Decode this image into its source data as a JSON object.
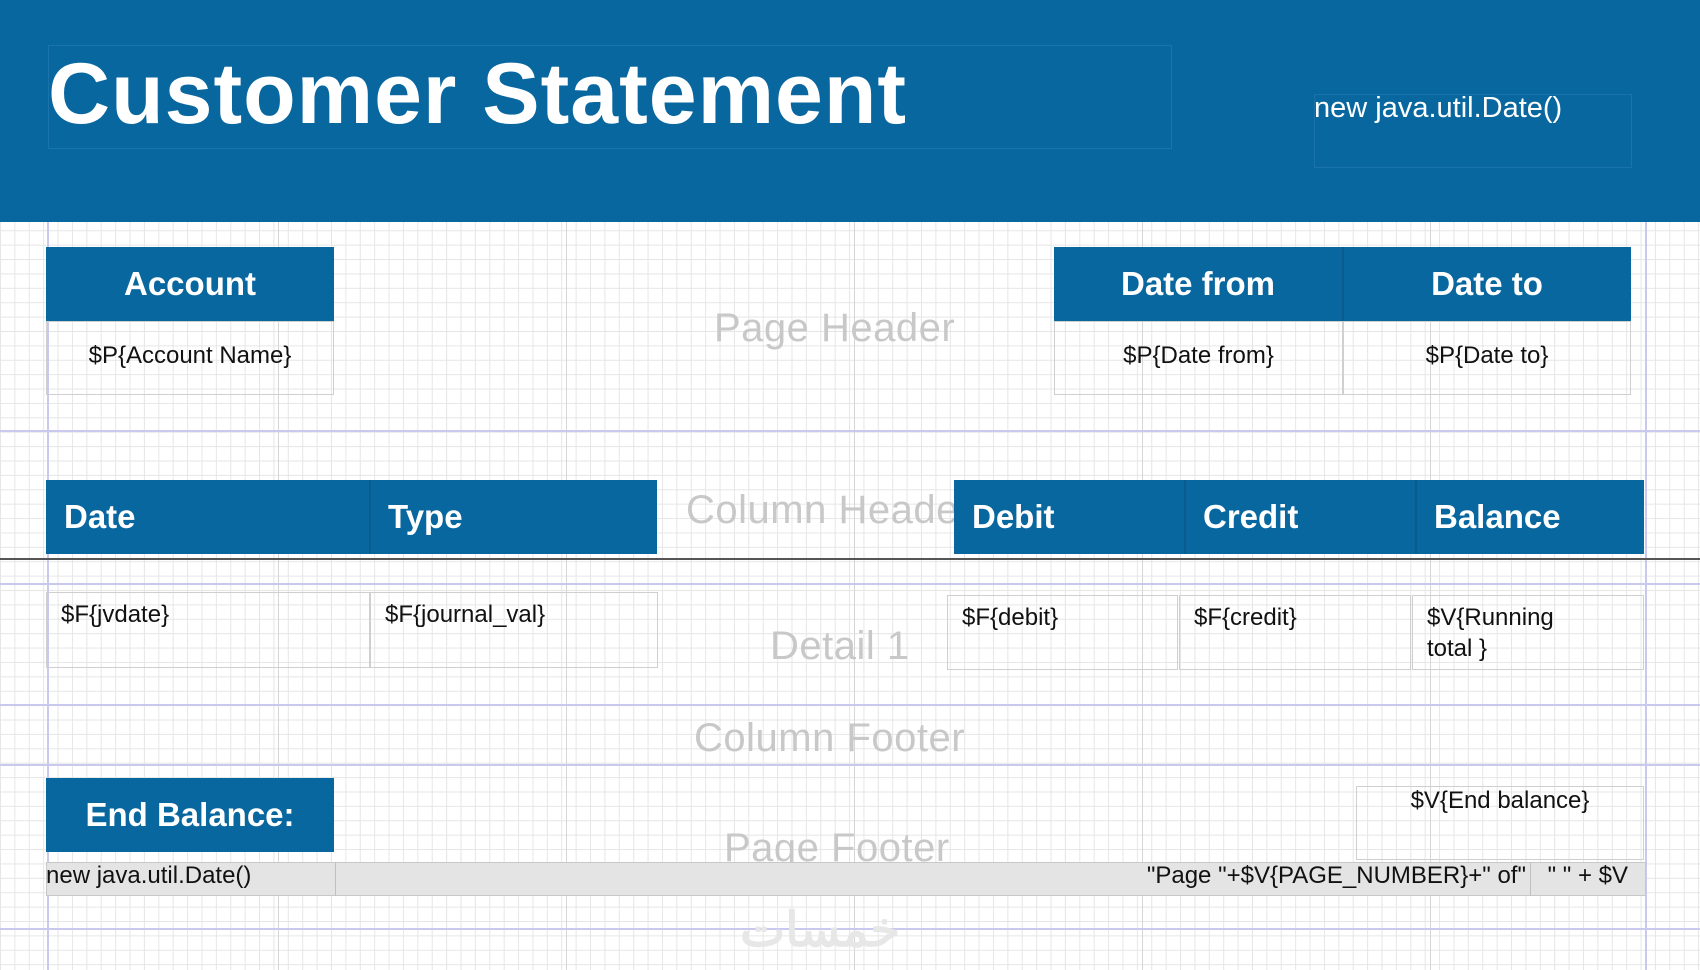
{
  "title": {
    "text": "Customer Statement",
    "date_expression": "new java.util.Date()"
  },
  "page_header": {
    "band_label": "Page Header",
    "account_header": "Account",
    "account_value": "$P{Account Name}",
    "date_from_header": "Date from",
    "date_from_value": "$P{Date from}",
    "date_to_header": "Date to",
    "date_to_value": "$P{Date to}"
  },
  "column_header": {
    "band_label": "Column Header",
    "columns": [
      "Date",
      "Type",
      "Debit",
      "Credit",
      "Balance"
    ]
  },
  "detail": {
    "band_label": "Detail 1",
    "fields": [
      "$F{jvdate}",
      "$F{journal_val}",
      "$F{debit}",
      "$F{credit}",
      "$V{Running total }"
    ]
  },
  "column_footer": {
    "band_label": "Column Footer"
  },
  "page_footer": {
    "band_label": "Page Footer",
    "end_balance_label": "End Balance:",
    "end_balance_value": "$V{End balance}",
    "date_expression": "new java.util.Date()",
    "page_number_expression": "\"Page \"+$V{PAGE_NUMBER}+\" of\"",
    "total_pages_expression": "\" \" + $V"
  },
  "watermark": "خمسات",
  "colors": {
    "header_blue": "#0967a0",
    "header_text": "#ffffff",
    "band_label": "#c8c8c8",
    "grid": "#e6e6e6",
    "band_line": "#c9c9f0"
  }
}
